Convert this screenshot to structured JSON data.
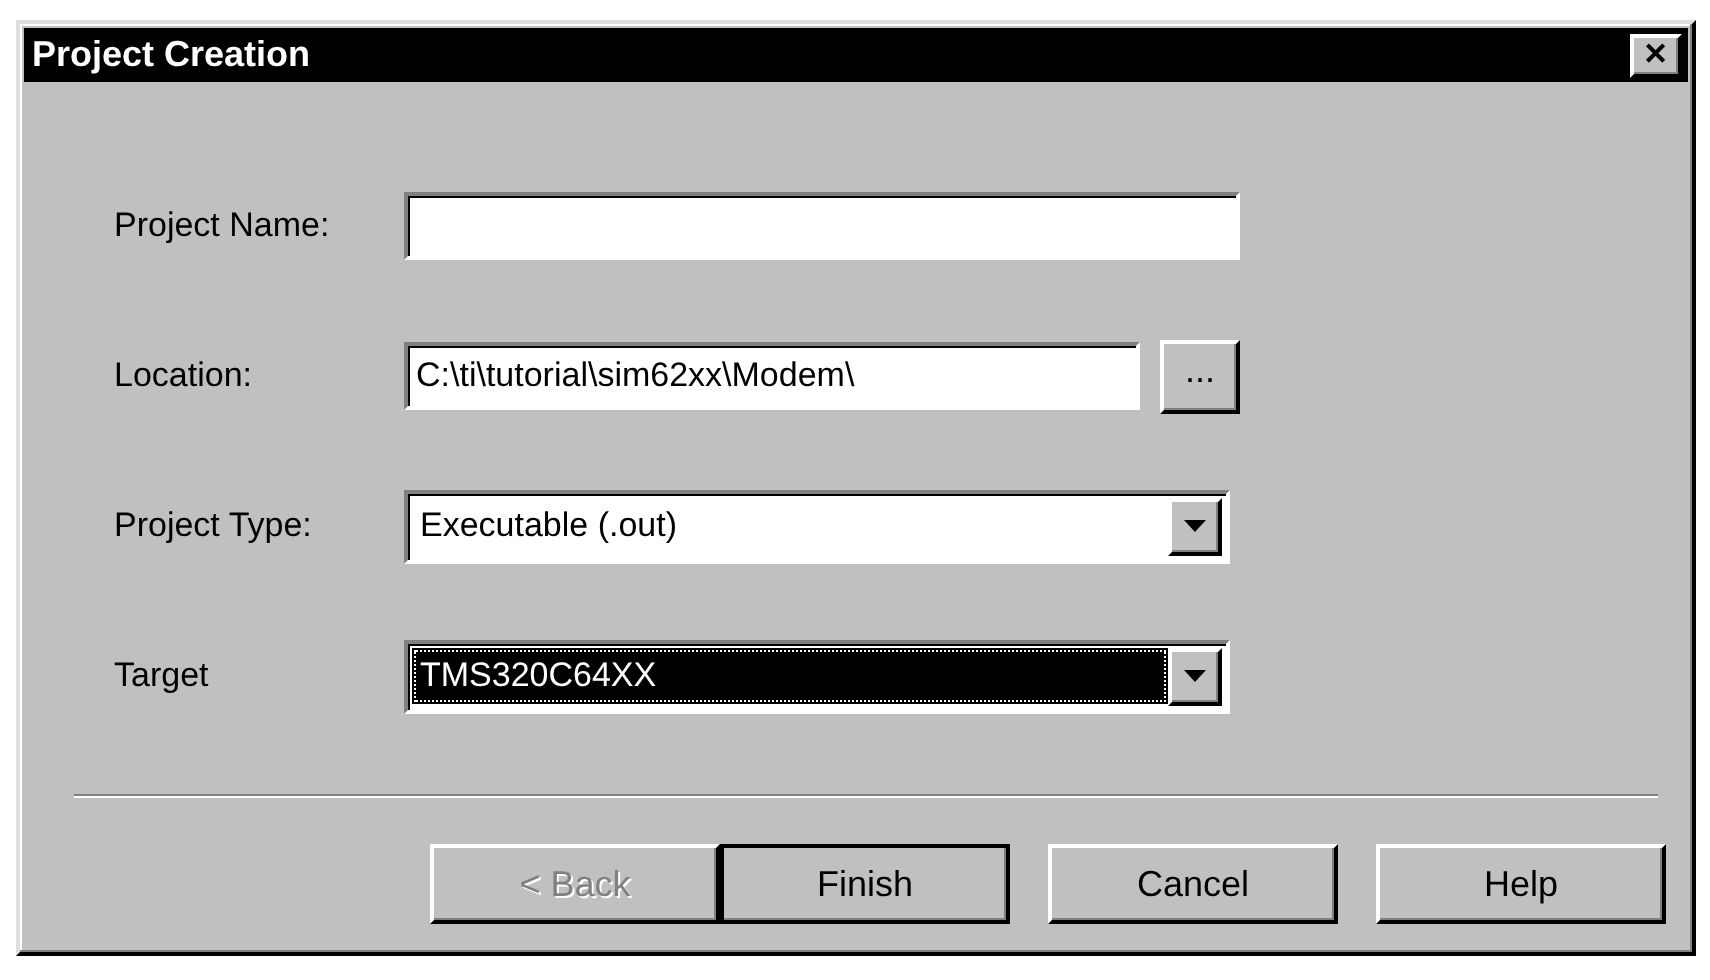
{
  "window": {
    "title": "Project Creation",
    "close_glyph": "✕"
  },
  "fields": [
    {
      "kind": "text",
      "label": "Project Name:"
    },
    {
      "kind": "browse",
      "label": "Location:",
      "value": "C:\\ti\\tutorial\\sim62xx\\Modem\\",
      "button": "..."
    },
    {
      "kind": "dropdown",
      "label": "Project Type:",
      "value": "Executable (.out)",
      "focused": false
    },
    {
      "kind": "dropdown",
      "label": "Target",
      "value": "TMS320C64XX",
      "focused": true
    }
  ],
  "buttons": [
    {
      "label": "< Back",
      "disabled": true,
      "default": false
    },
    {
      "label": "Finish",
      "disabled": false,
      "default": true
    },
    {
      "label": "Cancel",
      "disabled": false,
      "default": false
    },
    {
      "label": "Help",
      "disabled": false,
      "default": false
    }
  ]
}
